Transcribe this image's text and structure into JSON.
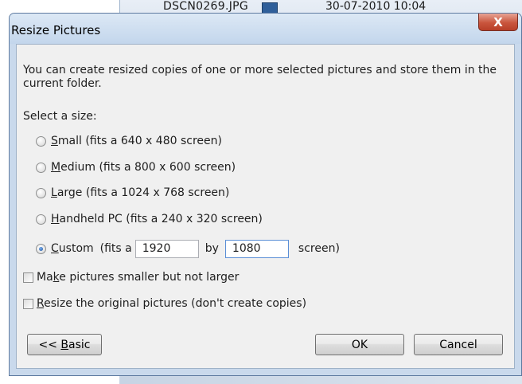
{
  "background": {
    "file_name": "DSCN0269.JPG",
    "file_date": "30-07-2010 10:04"
  },
  "dialog": {
    "title": "Resize Pictures",
    "close_label": "X",
    "description": "You can create resized copies of one or more selected pictures and store them in the current folder.",
    "select_label": "Select a size:",
    "options": [
      {
        "accel": "S",
        "label_rest": "mall (fits a 640 x 480 screen)",
        "checked": false
      },
      {
        "accel": "M",
        "label_rest": "edium (fits a 800 x 600 screen)",
        "checked": false
      },
      {
        "accel": "L",
        "label_rest": "arge (fits a 1024 x 768 screen)",
        "checked": false
      },
      {
        "accel": "H",
        "label_rest": "andheld PC (fits a 240 x 320 screen)",
        "checked": false
      }
    ],
    "custom": {
      "accel": "C",
      "label_rest": "ustom",
      "fits_text": "(fits a",
      "width_value": "1920",
      "by_text": "by",
      "height_value": "1080",
      "screen_text": "screen)",
      "checked": true
    },
    "checkbox_smaller": {
      "pre": "Ma",
      "accel": "k",
      "post": "e pictures smaller but not larger",
      "checked": false
    },
    "checkbox_original": {
      "accel": "R",
      "post": "esize the original pictures (don't create copies)",
      "checked": false
    },
    "basic_button": {
      "pre": "<< ",
      "accel": "B",
      "post": "asic"
    },
    "ok_label": "OK",
    "cancel_label": "Cancel"
  }
}
